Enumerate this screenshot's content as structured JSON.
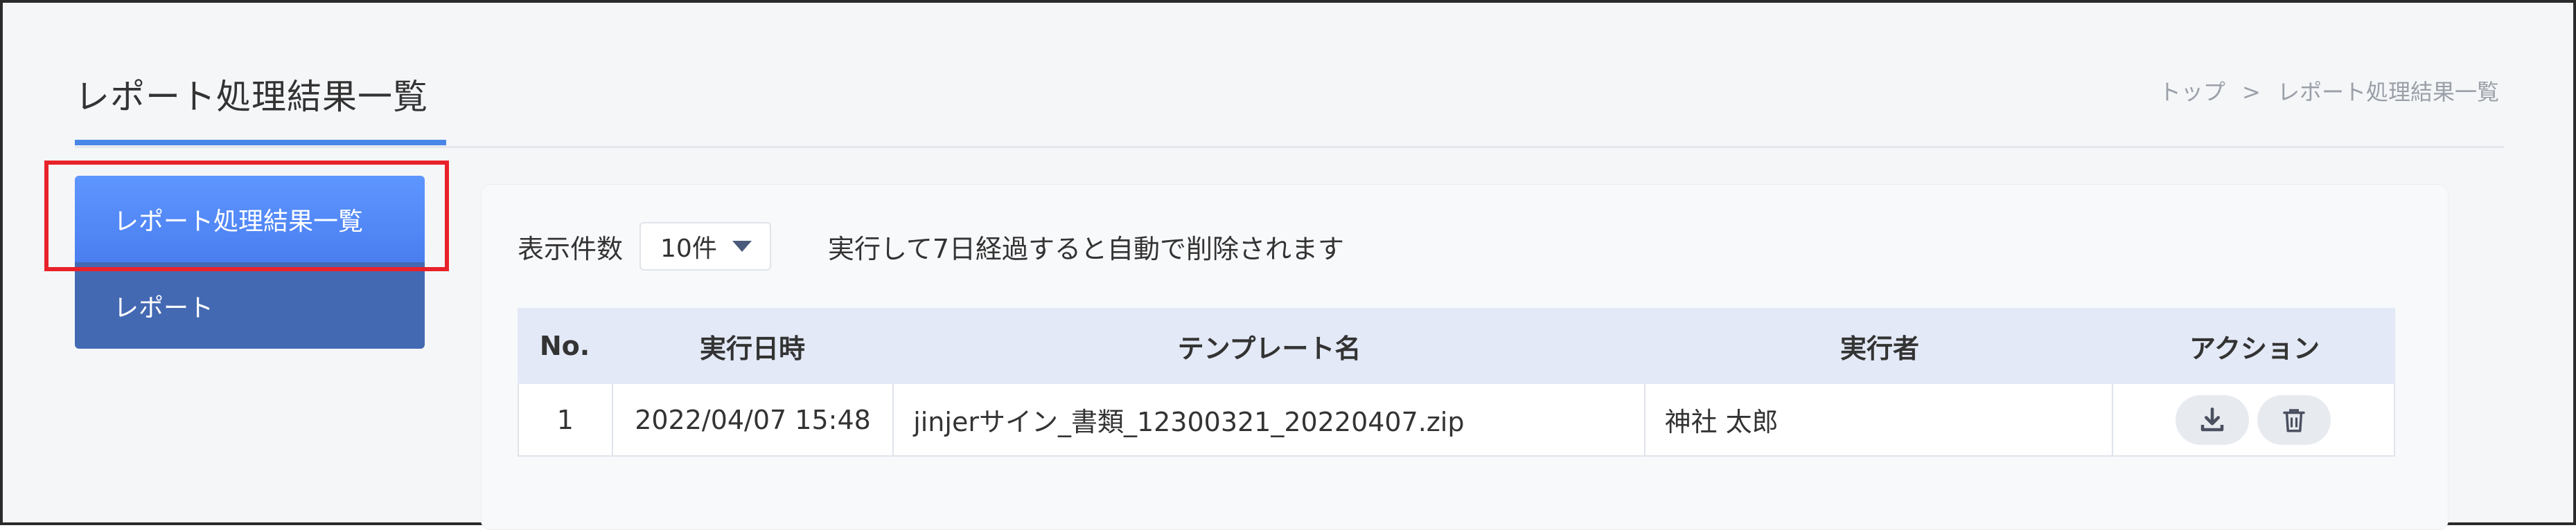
{
  "header": {
    "title": "レポート処理結果一覧",
    "breadcrumb": {
      "home": "トップ",
      "separator": ">",
      "current": "レポート処理結果一覧"
    }
  },
  "sidebar": {
    "items": [
      {
        "label": "レポート処理結果一覧",
        "active": true
      },
      {
        "label": "レポート",
        "active": false
      }
    ]
  },
  "controls": {
    "page_size_label": "表示件数",
    "page_size_value": "10件",
    "retention_note": "実行して7日経過すると自動で削除されます"
  },
  "table": {
    "columns": [
      "No.",
      "実行日時",
      "テンプレート名",
      "実行者",
      "アクション"
    ],
    "rows": [
      {
        "no": "1",
        "executed_at": "2022/04/07 15:48",
        "template": "jinjerサイン_書類_12300321_20220407.zip",
        "executor": "神社 太郎"
      }
    ]
  },
  "icons": {
    "download": "download-icon",
    "delete": "trash-icon"
  },
  "colors": {
    "accent": "#4a86e8",
    "nav_active": "#5e96ff",
    "nav_secondary": "#4469b3",
    "highlight": "#e8222a",
    "table_header": "#e3e9f6"
  }
}
